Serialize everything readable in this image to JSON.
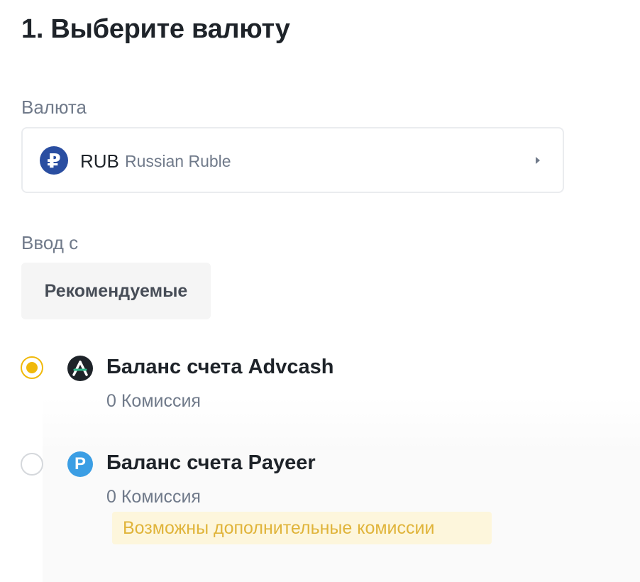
{
  "title": "1. Выберите валюту",
  "currency": {
    "label": "Валюта",
    "icon": "ruble-icon",
    "symbol": "₽",
    "code": "RUB",
    "name": "Russian Ruble"
  },
  "deposit_from": {
    "label": "Ввод с",
    "tab": "Рекомендуемые"
  },
  "methods": [
    {
      "name": "Баланс счета Advcash",
      "fee": "0 Комиссия",
      "selected": true,
      "icon": "advcash-icon",
      "icon_color": "#1e2329"
    },
    {
      "name": "Баланс счета Payeer",
      "fee": "0 Комиссия",
      "selected": false,
      "icon": "payeer-icon",
      "icon_letter": "P",
      "icon_color": "#3b9ee4",
      "note": "Возможны дополнительные комиссии"
    }
  ],
  "colors": {
    "accent": "#f0b90b",
    "note_text": "#e0b43a",
    "note_bg": "#fdf6dc"
  }
}
